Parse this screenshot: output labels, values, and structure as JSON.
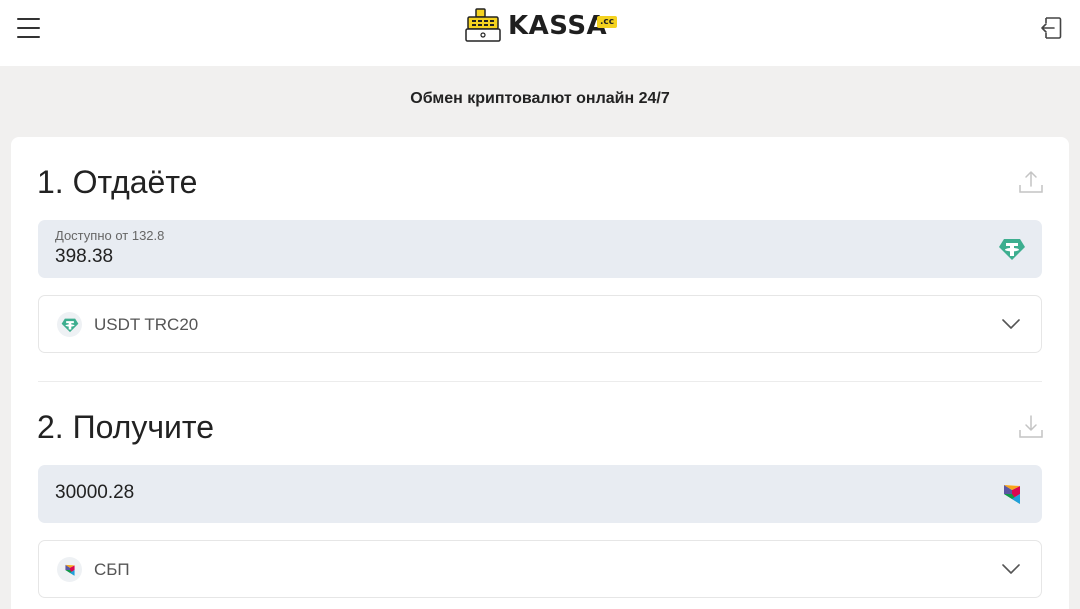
{
  "header": {
    "brand_name": "KASSA",
    "brand_badge": ".cc",
    "menu_icon": "hamburger-menu-icon",
    "logout_icon": "logout-icon"
  },
  "tagline": "Обмен криптовалют онлайн 24/7",
  "give": {
    "title": "1. Отдаёте",
    "available_hint": "Доступно от 132.8",
    "amount": "398.38",
    "currency": "USDT TRC20",
    "currency_icon": "tether-icon",
    "corner_icon": "upload-icon"
  },
  "receive": {
    "title": "2. Получите",
    "amount": "30000.28",
    "currency": "СБП",
    "currency_icon": "sbp-icon",
    "corner_icon": "download-icon"
  },
  "colors": {
    "tether": "#3dae8f",
    "brand_badge": "#f4d21f",
    "input_bg": "#e8ecf2"
  }
}
